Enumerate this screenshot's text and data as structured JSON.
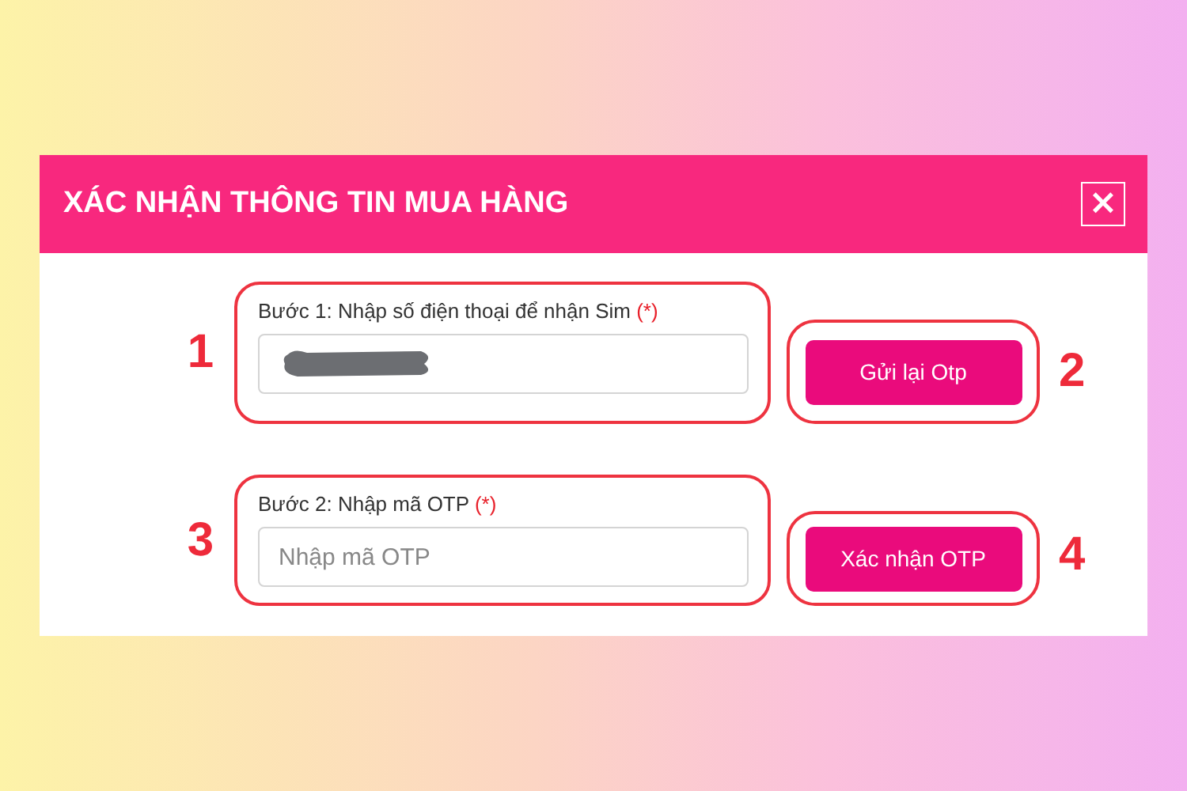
{
  "dialog": {
    "title": "XÁC NHẬN THÔNG TIN MUA HÀNG",
    "close_icon": "×",
    "steps": [
      {
        "number": "1",
        "label": "Bước 1: Nhập số điện thoại để nhận Sim",
        "required": "(*)",
        "value_redacted": true,
        "button": "Gửi lại Otp",
        "button_number": "2"
      },
      {
        "number": "3",
        "label": "Bước 2: Nhập mã OTP",
        "required": "(*)",
        "placeholder": "Nhập mã OTP",
        "value_redacted": false,
        "button": "Xác nhận OTP",
        "button_number": "4"
      }
    ]
  }
}
